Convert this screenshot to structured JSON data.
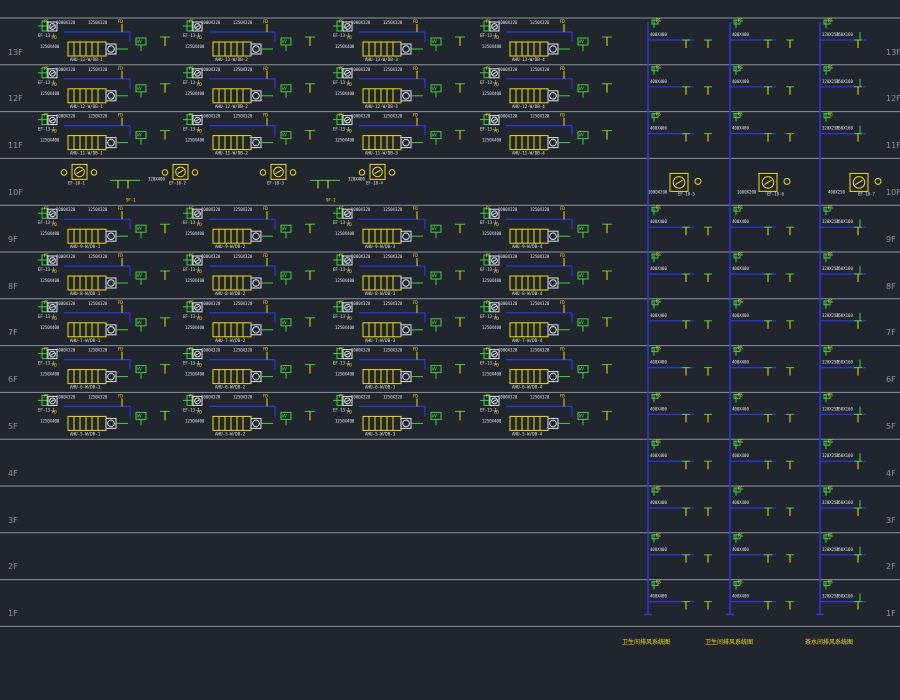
{
  "floors": [
    {
      "label": "13F",
      "has_ahu": true,
      "ahu_tags": [
        "AHU-13-W/DB-1",
        "AHU-13-W/DB-2",
        "AHU-13-W/DB-3",
        "AHU-13-W/DB-4"
      ]
    },
    {
      "label": "12F",
      "has_ahu": true,
      "ahu_tags": [
        "AHU-12-W/DB-1",
        "AHU-12-W/DB-2",
        "AHU-12-W/DB-3",
        "AHU-12-W/DB-4"
      ]
    },
    {
      "label": "11F",
      "has_ahu": true,
      "ahu_tags": [
        "AHU-11-W/DB-1",
        "AHU-11-W/DB-2",
        "AHU-11-W/DB-3",
        "AHU-11-W/DB-4"
      ]
    },
    {
      "label": "10F",
      "has_ahu": false,
      "ahu_tags": []
    },
    {
      "label": "9F",
      "has_ahu": true,
      "ahu_tags": [
        "AHU-9-W/DB-1",
        "AHU-9-W/DB-2",
        "AHU-9-W/DB-3",
        "AHU-9-W/DB-4"
      ]
    },
    {
      "label": "8F",
      "has_ahu": true,
      "ahu_tags": [
        "AHU-8-W/DB-1",
        "AHU-8-W/DB-2",
        "AHU-8-W/DB-3",
        "AHU-8-W/DB-4"
      ]
    },
    {
      "label": "7F",
      "has_ahu": true,
      "ahu_tags": [
        "AHU-7-W/DB-1",
        "AHU-7-W/DB-2",
        "AHU-7-W/DB-3",
        "AHU-7-W/DB-4"
      ]
    },
    {
      "label": "6F",
      "has_ahu": true,
      "ahu_tags": [
        "AHU-6-W/DB-1",
        "AHU-6-W/DB-2",
        "AHU-6-W/DB-3",
        "AHU-6-W/DB-4"
      ]
    },
    {
      "label": "5F",
      "has_ahu": true,
      "ahu_tags": [
        "AHU-5-W/DB-1",
        "AHU-5-W/DB-2",
        "AHU-5-W/DB-3",
        "AHU-5-W/DB-4"
      ]
    },
    {
      "label": "4F",
      "has_ahu": false,
      "ahu_tags": []
    },
    {
      "label": "3F",
      "has_ahu": false,
      "ahu_tags": []
    },
    {
      "label": "2F",
      "has_ahu": false,
      "ahu_tags": []
    },
    {
      "label": "1F",
      "has_ahu": false,
      "ahu_tags": []
    }
  ],
  "unit_texts": {
    "fan_tag": "EF-13-1",
    "duct_size_a": "1250X320",
    "duct_size_b": "1000X320",
    "fan_symbol": "FS",
    "damper_symbol": "FD",
    "valve_symbol": "WV",
    "size_note": "1250X400"
  },
  "floor_10_fans": [
    "EF-10-1",
    "EF-10-2",
    "EF-10-3",
    "EF-10-4"
  ],
  "floor_10_fan_sizes": [
    "320X400",
    "320X400"
  ],
  "floor_10_tags": [
    "9F-1",
    "9F-2"
  ],
  "risers": {
    "branch_sizes": [
      "400X250",
      "400X250",
      "250X160"
    ],
    "riser_sizes": [
      "400X400",
      "400X400",
      "320X250"
    ],
    "roof_fans": [
      "EF-10-5",
      "EF-10-6",
      "EF-10-7"
    ],
    "roof_fan_sizes": [
      "1000X200",
      "1000X200",
      "400X250"
    ]
  },
  "legend": {
    "left": "卫生间排风系统图",
    "middle": "卫生间排风系统图",
    "right": "茶水间排风系统图"
  },
  "colors": {
    "background": "#21252e",
    "floor_line": "#8d939c",
    "yellow": "#f0e000",
    "green": "#3fd23c",
    "blue": "#2c36e6",
    "white": "#dfe3ea"
  }
}
